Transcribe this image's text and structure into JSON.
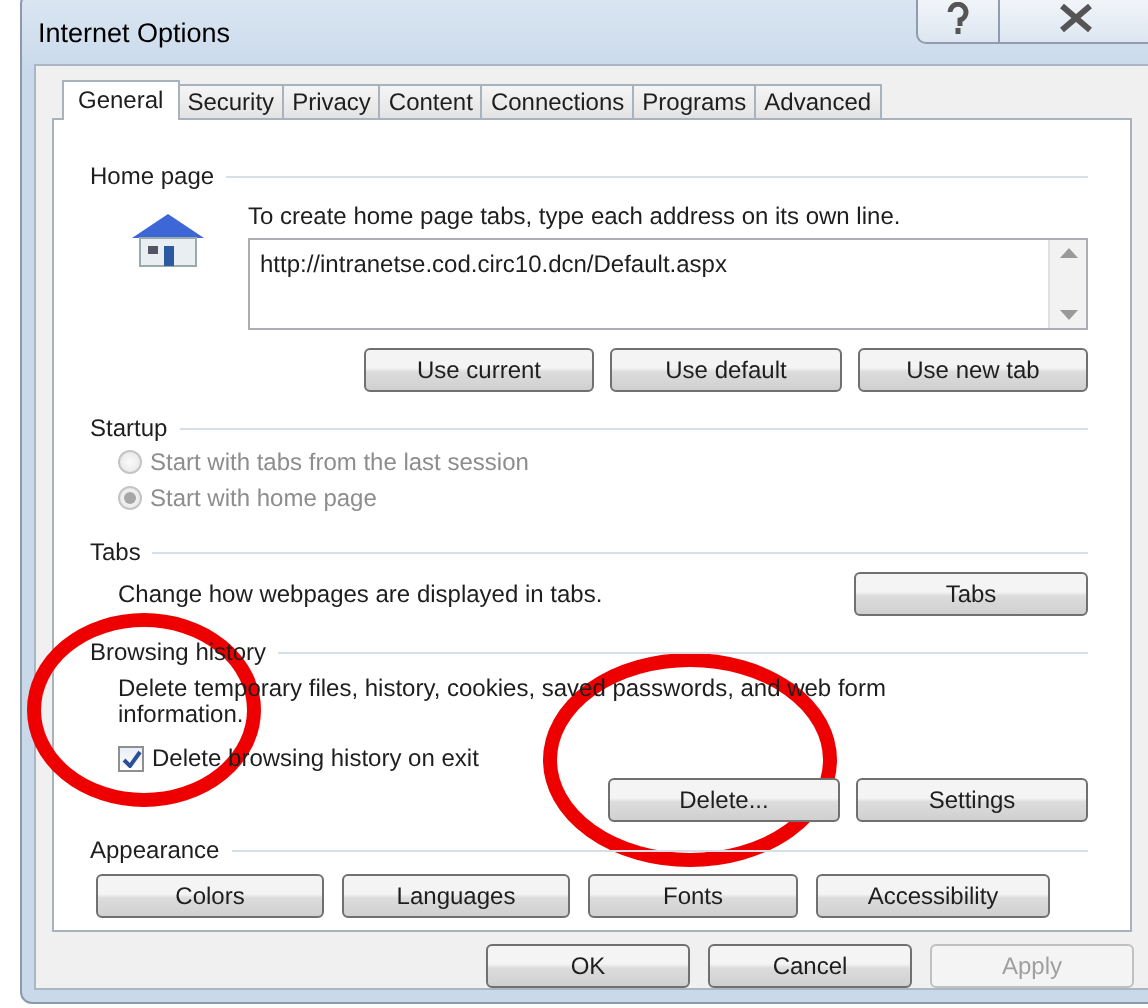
{
  "window": {
    "title": "Internet Options"
  },
  "tabs": [
    {
      "label": "General",
      "selected": true
    },
    {
      "label": "Security",
      "selected": false
    },
    {
      "label": "Privacy",
      "selected": false
    },
    {
      "label": "Content",
      "selected": false
    },
    {
      "label": "Connections",
      "selected": false
    },
    {
      "label": "Programs",
      "selected": false
    },
    {
      "label": "Advanced",
      "selected": false
    }
  ],
  "home_page": {
    "heading": "Home page",
    "instruction": "To create home page tabs, type each address on its own line.",
    "addresses": "http://intranetse.cod.circ10.dcn/Default.aspx",
    "buttons": [
      "Use current",
      "Use default",
      "Use new tab"
    ]
  },
  "startup": {
    "heading": "Startup",
    "options": [
      {
        "label": "Start with tabs from the last session",
        "selected": false,
        "disabled": true
      },
      {
        "label": "Start with home page",
        "selected": true,
        "disabled": true
      }
    ]
  },
  "tabs_section": {
    "heading": "Tabs",
    "description": "Change how webpages are displayed in tabs.",
    "button": "Tabs"
  },
  "browsing_history": {
    "heading": "Browsing history",
    "description": "Delete temporary files, history, cookies, saved passwords, and web form information.",
    "delete_on_exit": {
      "label": "Delete browsing history on exit",
      "checked": true
    },
    "buttons": [
      "Delete...",
      "Settings"
    ]
  },
  "appearance": {
    "heading": "Appearance",
    "buttons": [
      "Colors",
      "Languages",
      "Fonts",
      "Accessibility"
    ]
  },
  "footer_buttons": [
    {
      "label": "OK",
      "disabled": false
    },
    {
      "label": "Cancel",
      "disabled": false
    },
    {
      "label": "Apply",
      "disabled": true
    }
  ],
  "annotations": [
    {
      "kind": "circle"
    },
    {
      "kind": "circle"
    }
  ]
}
